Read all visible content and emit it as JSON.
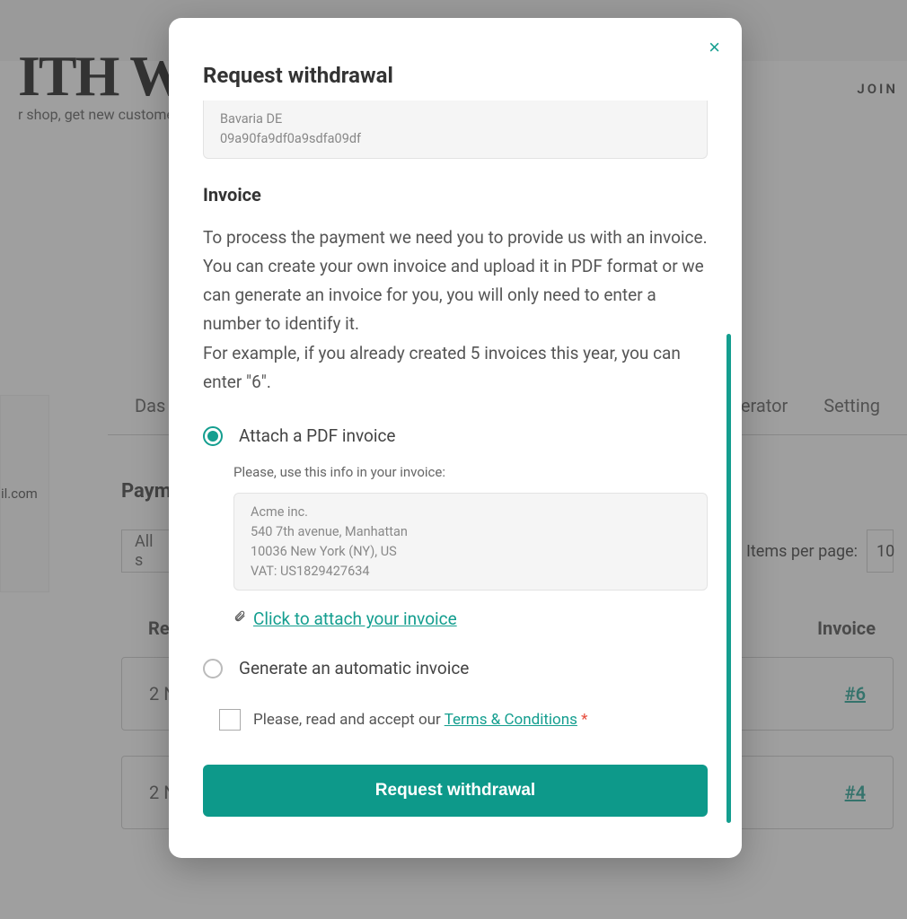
{
  "background": {
    "logo_fragment": "ITH W",
    "tagline_fragment": "r shop, get new customers an",
    "join": "JOIN",
    "email_fragment": "il.com",
    "tabs": {
      "left": "Das",
      "generator": "generator",
      "settings": "Setting"
    },
    "section_label": "Paym",
    "filter_all": "All s",
    "items_per_page_label": "Items per page:",
    "items_per_page_value": "10",
    "th_left": "Re",
    "th_right": "Invoice",
    "rows": [
      {
        "label": "2 N",
        "invoice": "#6"
      },
      {
        "label": "2 N",
        "invoice": "#4"
      }
    ]
  },
  "modal": {
    "title": "Request withdrawal",
    "prev_box_line1": "Bavaria DE",
    "prev_box_line2": "09a90fa9df0a9sdfa09df",
    "invoice_heading": "Invoice",
    "invoice_p1": "To process the payment we need you to provide us with an invoice. You can create your own invoice and upload it in PDF format or we can generate an invoice for you, you will only need to enter a number to identify it.",
    "invoice_p2": "For example, if you already created 5 invoices this year, you can enter \"6\".",
    "radio_attach": "Attach a PDF invoice",
    "sub_hint": "Please, use this info in your invoice:",
    "company": {
      "name": "Acme inc.",
      "address": "540 7th avenue, Manhattan",
      "city": "10036 New York (NY), US",
      "vat": "VAT: US1829427634"
    },
    "attach_link": "Click to attach your invoice",
    "radio_generate": "Generate an automatic invoice",
    "terms_prefix": "Please, read and accept our ",
    "terms_link": "Terms & Conditions",
    "submit": "Request withdrawal"
  }
}
